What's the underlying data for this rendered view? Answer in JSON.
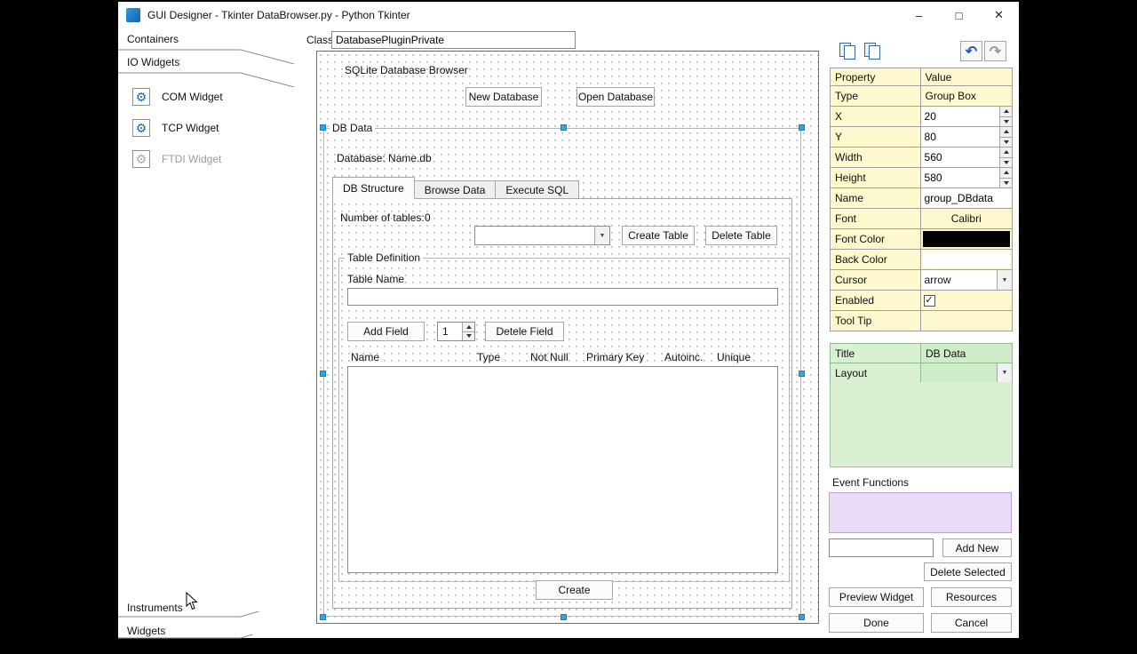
{
  "window": {
    "title": "GUI Designer - Tkinter DataBrowser.py - Python Tkinter",
    "controls": {
      "minimize": "–",
      "maximize": "□",
      "close": "✕"
    }
  },
  "icons": {
    "gear": "⚙",
    "undo": "↶",
    "redo": "↷",
    "dropdown_arrow": "▼",
    "check": "✓"
  },
  "sidebar": {
    "sections_top": [
      {
        "label": "Containers"
      },
      {
        "label": "IO Widgets"
      }
    ],
    "widgets": [
      {
        "label": "COM Widget",
        "enabled": true
      },
      {
        "label": "TCP Widget",
        "enabled": true
      },
      {
        "label": "FTDI Widget",
        "enabled": false
      }
    ],
    "sections_bottom": [
      {
        "label": "Instruments"
      },
      {
        "label": "Widgets"
      }
    ]
  },
  "header": {
    "class_label": "Class:",
    "class_value": "DatabasePluginPrivate"
  },
  "canvas": {
    "form_title": "SQLite Database Browser",
    "new_database_button": "New Database",
    "open_database_button": "Open Database",
    "group_title": "DB Data",
    "database_label": "Database: Name.db",
    "tabs": [
      {
        "label": "DB Structure"
      },
      {
        "label": "Browse Data"
      },
      {
        "label": "Execute SQL"
      }
    ],
    "number_of_tables_label": "Number of tables:",
    "number_of_tables_value": "0",
    "table_dropdown_value": "",
    "create_table_button": "Create Table",
    "delete_table_button": "Delete Table",
    "table_definition_title": "Table Definition",
    "table_name_label": "Table Name",
    "table_name_value": "",
    "add_field_button": "Add Field",
    "field_spinner_value": "1",
    "delete_field_button": "Detele Field",
    "field_columns": [
      "Name",
      "Type",
      "Not Null",
      "Primary Key",
      "Autoinc.",
      "Unique"
    ],
    "create_button": "Create"
  },
  "inspector": {
    "grid_header": {
      "property": "Property",
      "value": "Value"
    },
    "rows": {
      "type": {
        "label": "Type",
        "value": "Group Box"
      },
      "x": {
        "label": "X",
        "value": "20"
      },
      "y": {
        "label": "Y",
        "value": "80"
      },
      "width": {
        "label": "Width",
        "value": "560"
      },
      "height": {
        "label": "Height",
        "value": "580"
      },
      "name": {
        "label": "Name",
        "value": "group_DBdata"
      },
      "font": {
        "label": "Font",
        "value": "Calibri"
      },
      "font_color": {
        "label": "Font Color",
        "value": "#000000"
      },
      "back_color": {
        "label": "Back Color",
        "value": "#ffffff"
      },
      "cursor": {
        "label": "Cursor",
        "value": "arrow"
      },
      "enabled": {
        "label": "Enabled",
        "checked": true
      },
      "tool_tip": {
        "label": "Tool Tip",
        "value": ""
      }
    },
    "title_row": {
      "label": "Title",
      "value": "DB Data"
    },
    "layout_row": {
      "label": "Layout",
      "value": ""
    }
  },
  "events": {
    "section_label": "Event Functions",
    "function_input_value": "",
    "add_new_button": "Add New",
    "delete_selected_button": "Delete Selected",
    "preview_widget_button": "Preview Widget",
    "resources_button": "Resources",
    "done_button": "Done",
    "cancel_button": "Cancel"
  },
  "colors": {
    "property_row_bg": "#fdf8cd",
    "green_section_bg": "#d9f0d2",
    "event_box_bg": "#eadcf6",
    "selection_handle": "#35a3dc",
    "font_color_swatch": "#000000",
    "back_color_swatch": "#ffffff"
  }
}
